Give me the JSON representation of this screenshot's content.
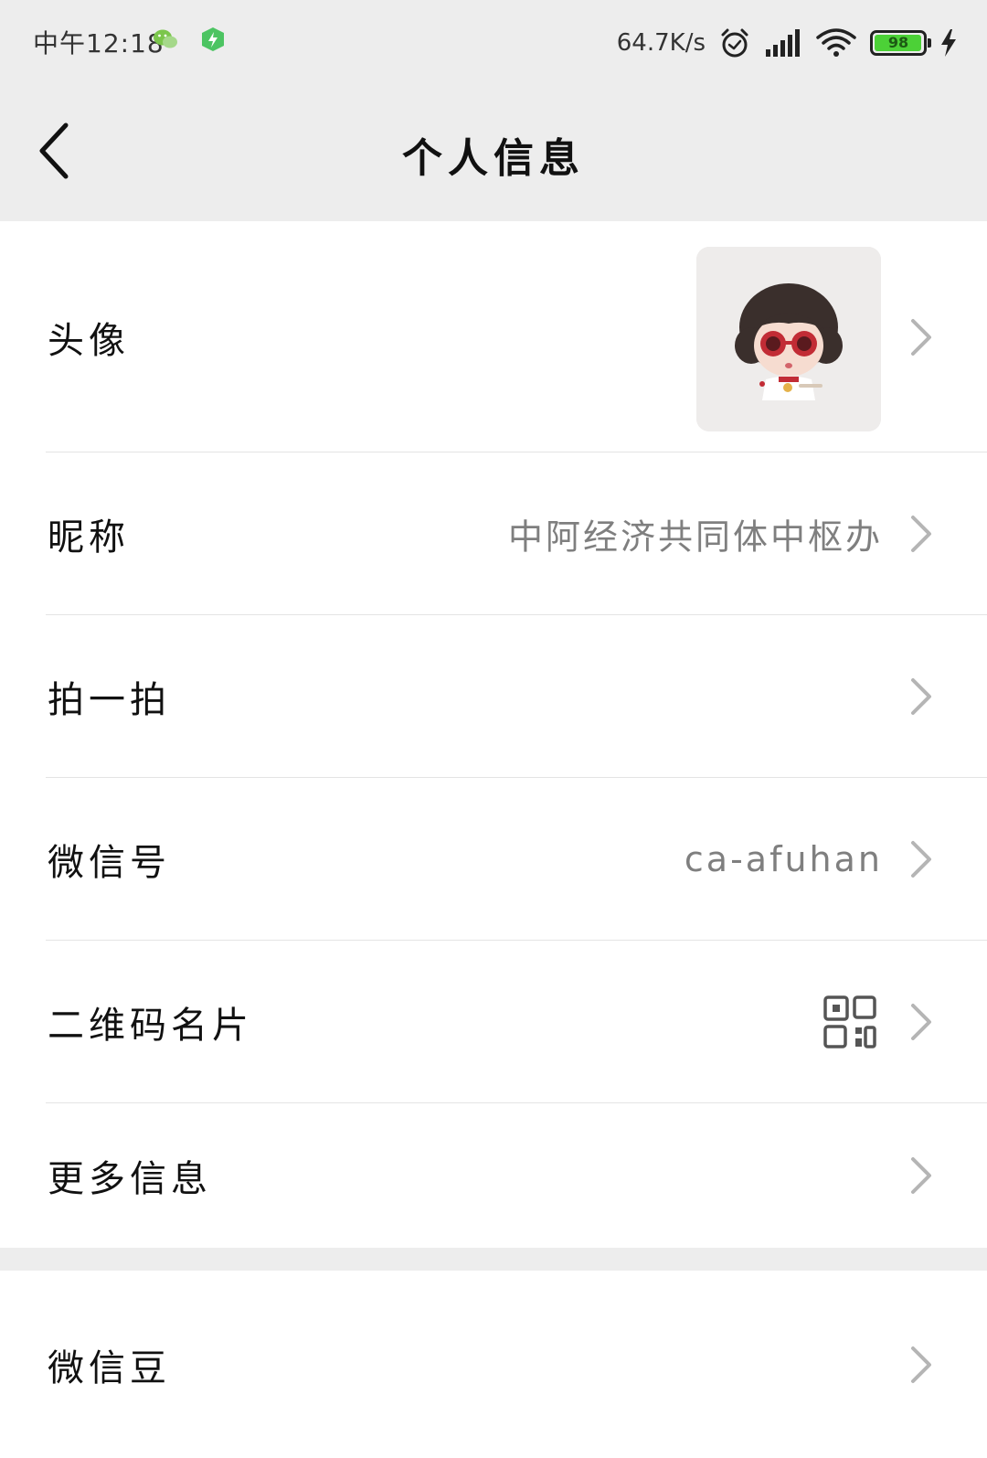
{
  "status_bar": {
    "time": "中午12:18",
    "net_speed": "64.7K/s",
    "battery_level": "98",
    "battery_percent": 98,
    "icons": [
      "wechat-icon",
      "security-shield-icon",
      "alarm-icon",
      "signal-icon",
      "wifi-icon",
      "battery-icon",
      "charging-icon"
    ]
  },
  "nav": {
    "title": "个人信息",
    "back_icon": "back-arrow-icon"
  },
  "profile": {
    "rows": [
      {
        "label": "头像",
        "value": "",
        "type": "avatar"
      },
      {
        "label": "昵称",
        "value": "中阿经济共同体中枢办"
      },
      {
        "label": "拍一拍",
        "value": ""
      },
      {
        "label": "微信号",
        "value": "ca-afuhan"
      },
      {
        "label": "二维码名片",
        "value": "",
        "type": "qr-code-icon"
      },
      {
        "label": "更多信息",
        "value": ""
      }
    ]
  },
  "extra": {
    "rows": [
      {
        "label": "微信豆",
        "value": ""
      }
    ]
  },
  "colors": {
    "background": "#ededed",
    "card": "#ffffff",
    "secondary_text": "#7f7f7f",
    "chevron": "#b5b5b5",
    "battery_fill": "#4cd137",
    "wechat_green": "#7bc64c"
  }
}
